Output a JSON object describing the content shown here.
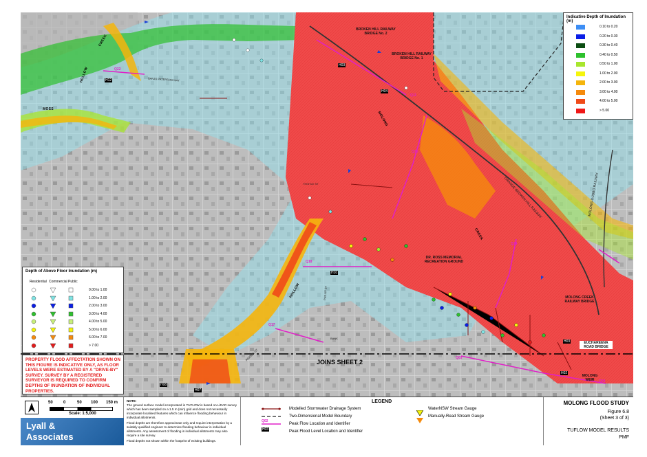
{
  "depth_legend": {
    "title": "Indicative Depth of Inundation (m)",
    "items": [
      {
        "label": "0.10 to 0.20",
        "color": "#3d8ef5"
      },
      {
        "label": "0.20 to 0.30",
        "color": "#0a1ee6"
      },
      {
        "label": "0.30 to 0.40",
        "color": "#0b4d12"
      },
      {
        "label": "0.40 to 0.50",
        "color": "#2ec12e"
      },
      {
        "label": "0.50 to 1.00",
        "color": "#a8e62e"
      },
      {
        "label": "1.00 to 2.00",
        "color": "#f5f50c"
      },
      {
        "label": "2.00 to 3.00",
        "color": "#f5b50c"
      },
      {
        "label": "3.00 to 4.00",
        "color": "#f58a0c"
      },
      {
        "label": "4.00 to 5.00",
        "color": "#f04a18"
      },
      {
        "label": "> 5.00",
        "color": "#f01818"
      }
    ]
  },
  "floor_legend": {
    "title": "Depth of Above Floor Inundation (m)",
    "headers": [
      "Residential",
      "Commercial",
      "Public"
    ],
    "items": [
      {
        "label": "0.00 to 1.00",
        "color": "#ffffff"
      },
      {
        "label": "1.00 to 2.00",
        "color": "#7fe5e5"
      },
      {
        "label": "2.00 to 3.00",
        "color": "#0a1ee6"
      },
      {
        "label": "3.00 to 4.00",
        "color": "#2ec12e"
      },
      {
        "label": "4.00 to 5.00",
        "color": "#c8f07a"
      },
      {
        "label": "5.00 to 6.00",
        "color": "#f5f50c"
      },
      {
        "label": "6.00 to 7.00",
        "color": "#f58a0c"
      },
      {
        "label": "> 7.00",
        "color": "#e41b1b"
      }
    ]
  },
  "warning": {
    "text": "PROPERTY FLOOD AFFECTATION SHOWN ON THIS FIGURE IS INDICATIVE ONLY, AS FLOOR LEVELS WERE ESTIMATED BY A \"DRIVE-BY\" SURVEY. SURVEY BY A REGISTERED SURVEYOR IS REQUIRED TO CONFIRM DEPTHS OF INUNDATION OF INDIVIDUAL PROPERTIES."
  },
  "scale": {
    "ticks": [
      "0",
      "50",
      "0",
      "50",
      "100",
      "150 m"
    ],
    "label": "Scale: 1:5,000"
  },
  "company": {
    "line1": "Lyall &",
    "line2": "Associates"
  },
  "note": {
    "title": "NOTE:",
    "p1": "The ground surface model incorporated in TUFLOW is based on LiDAR survey which has been sampled on a 1.5 m (min) grid and does not necessarily incorporate localised features which can influence flooding behaviour in individual allotments.",
    "p2": "Flood depths are therefore approximate only and require interpretation by a suitably qualified engineer to determine flooding behaviour in individual allotments. Any assessment of flooding in individual allotments may also require a site survey.",
    "p3": "Flood depths not shown within the footprint of existing buildings."
  },
  "legend": {
    "title": "LEGEND",
    "items": [
      "Modelled Stormwater Drainage System",
      "Two-Dimensional Model Boundary",
      "Peak Flow Location and Identifier",
      "Peak Flood Level Location and Identifier",
      "WaterNSW Stream Gauge",
      "Manually-Read Stream Gauge"
    ],
    "q_tag": "Q02",
    "h_tag": "H03"
  },
  "title_block": {
    "study": "MOLONG FLOOD STUDY",
    "figure": "Figure 6.8",
    "sheet": "(Sheet 3 of 3)",
    "subtitle": "TUFLOW MODEL RESULTS",
    "event": "PMF"
  },
  "map_labels": {
    "joins": "JOINS SHEET 2",
    "bridge2": "BROKEN HILL RAILWAY BRIDGE No. 2",
    "bridge1": "BROKEN HILL RAILWAY BRIDGE No. 1",
    "ross": "DR. ROSS MEMORIAL RECREATION GROUND",
    "creek_bridge": "MOLONG CREEK RAILWAY BRIDGE",
    "euch": "EUCHAREENA ROAD BRIDGE",
    "weir": "MOLONG WEIR",
    "molong": "MOLONG",
    "creek": "CREEK",
    "hollow1": "HOLLOW",
    "creek2": "CREEK",
    "moss": "MOSS",
    "hollow2": "HOLLOW",
    "orange": "ORANGE-BROKEN HILL RAILWAY",
    "molong_dubbo": "MOLONG-DUBBO RAILWAY",
    "bank": "BANK",
    "riddell": "RIDDELL ST",
    "thistle": "THISTLE ST",
    "phillip": "PHILLIP ST",
    "banjo": "BANJO PATERSON WAY"
  },
  "map_tags": {
    "q_north": "Q11",
    "q_mid": "Q15",
    "q_east": "Q14",
    "q_west": "Q18",
    "q_sw": "Q17",
    "q_left": "Q22",
    "h_left": "H12",
    "h_bridge": "H03",
    "h_bridge2": "H04",
    "h_mid": "H10",
    "h_sw": "H07",
    "h_ss": "H08",
    "h_se": "H02",
    "h_e": "H03",
    "q_se": "Q04",
    "q_south": "Q03"
  }
}
